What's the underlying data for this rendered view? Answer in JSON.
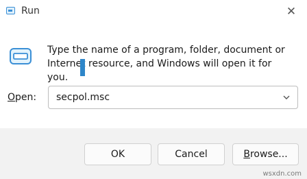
{
  "window": {
    "title": "Run",
    "close_glyph": "✕"
  },
  "description": {
    "line1": "Type the name of a program, folder, document or",
    "line2": "Internet resource, and Windows will open it for you."
  },
  "open_field": {
    "label_accel": "O",
    "label_rest": "pen:",
    "value": "secpol.msc"
  },
  "buttons": {
    "ok": "OK",
    "cancel": "Cancel",
    "browse_accel": "B",
    "browse_rest": "rowse..."
  },
  "watermark": "wsxdn.com",
  "icons": {
    "app": "run-icon",
    "close": "close-icon",
    "dropdown": "chevron-down-icon"
  },
  "colors": {
    "accent": "#3a8fd6",
    "footer": "#f2f2f2"
  }
}
